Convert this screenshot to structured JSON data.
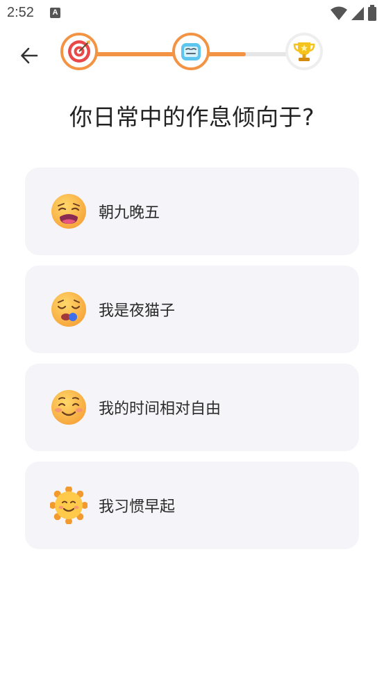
{
  "status_bar": {
    "time": "2:52",
    "notification_icon": "A"
  },
  "header": {
    "back_icon": "arrow-left-icon",
    "progress": {
      "steps": [
        {
          "icon": "target-icon",
          "state": "done"
        },
        {
          "icon": "alarm-clock-icon",
          "state": "current"
        },
        {
          "icon": "trophy-icon",
          "state": "todo"
        }
      ],
      "fill_fraction": 0.74,
      "accent_color": "#f39445"
    }
  },
  "question": {
    "title": "你日常中的作息倾向于?"
  },
  "options": [
    {
      "label": "朝九晚五",
      "emoji": "tired-face-icon"
    },
    {
      "label": "我是夜猫子",
      "emoji": "sleepy-face-icon"
    },
    {
      "label": "我的时间相对自由",
      "emoji": "smiling-face-icon"
    },
    {
      "label": "我习惯早起",
      "emoji": "sun-face-icon"
    }
  ]
}
